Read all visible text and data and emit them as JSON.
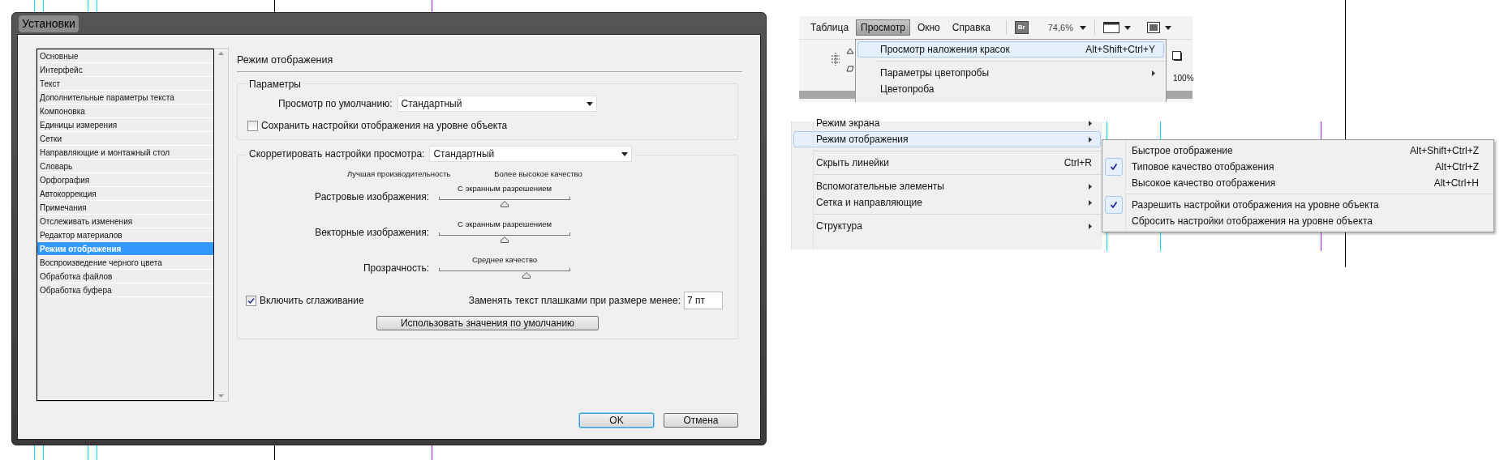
{
  "dialog": {
    "title": "Установки",
    "categories": [
      {
        "label": "Основные",
        "selected": false
      },
      {
        "label": "Интерфейс",
        "selected": false
      },
      {
        "label": "Текст",
        "selected": false
      },
      {
        "label": "Дополнительные параметры текста",
        "selected": false
      },
      {
        "label": "Компоновка",
        "selected": false
      },
      {
        "label": "Единицы измерения",
        "selected": false
      },
      {
        "label": "Сетки",
        "selected": false
      },
      {
        "label": "Направляющие и монтажный стол",
        "selected": false
      },
      {
        "label": "Словарь",
        "selected": false
      },
      {
        "label": "Орфография",
        "selected": false
      },
      {
        "label": "Автокоррекция",
        "selected": false
      },
      {
        "label": "Примечания",
        "selected": false
      },
      {
        "label": "Отслеживать изменения",
        "selected": false
      },
      {
        "label": "Редактор материалов",
        "selected": false
      },
      {
        "label": "Режим отображения",
        "selected": true
      },
      {
        "label": "Воспроизведение черного цвета",
        "selected": false
      },
      {
        "label": "Обработка файлов",
        "selected": false
      },
      {
        "label": "Обработка буфера",
        "selected": false
      }
    ],
    "panel": {
      "heading": "Режим отображения",
      "params_group": {
        "title": "Параметры",
        "default_view_label": "Просмотр по умолчанию:",
        "default_view_value": "Стандартный",
        "keep_object_settings": {
          "label": "Сохранить настройки отображения на уровне объекта",
          "checked": false
        }
      },
      "adjust_group": {
        "label": "Скорретировать настройки просмотра:",
        "value": "Стандартный",
        "scale_left": "Лучшая производительность",
        "scale_right": "Более высокое качество",
        "sliders": [
          {
            "label": "Растровые изображения:",
            "reading": "С экранным разрешением",
            "level": 0.5
          },
          {
            "label": "Векторные изображения:",
            "reading": "С экранным разрешением",
            "level": 0.5
          },
          {
            "label": "Прозрачность:",
            "reading": "Среднее качество",
            "level": 0.667
          }
        ],
        "antialias": {
          "label": "Включить сглаживание",
          "checked": true
        },
        "greek_label": "Заменять текст плашками при размере менее:",
        "greek_value": "7 пт",
        "defaults_button": "Использовать значения по умолчанию"
      }
    },
    "buttons": [
      {
        "label": "OK",
        "default": true
      },
      {
        "label": "Отмена",
        "default": false
      }
    ]
  },
  "menubar": {
    "items": [
      {
        "label": "Таблица",
        "selected": false
      },
      {
        "label": "Просмотр",
        "selected": true
      },
      {
        "label": "Окно",
        "selected": false
      },
      {
        "label": "Справка",
        "selected": false
      }
    ],
    "bridge_badge": "Br",
    "zoom": "74,6%",
    "toolbar_zoom": "100%"
  },
  "view_menu": {
    "items": [
      {
        "label": "Просмотр наложения красок",
        "shortcut": "Alt+Shift+Ctrl+Y",
        "highlighted": true,
        "submenu": false,
        "separator_after": true
      },
      {
        "label": "Параметры цветопробы",
        "highlighted": false,
        "submenu": true,
        "separator_after": false
      },
      {
        "label": "Цветопроба",
        "highlighted": false,
        "submenu": false
      }
    ]
  },
  "view_menu_lower": {
    "items": [
      {
        "label": "Режим экрана",
        "highlighted": false,
        "submenu": true,
        "separator_after": false
      },
      {
        "label": "Режим отображения",
        "highlighted": true,
        "submenu": true,
        "separator_after": true
      },
      {
        "label": "Скрыть линейки",
        "shortcut": "Ctrl+R",
        "highlighted": false,
        "submenu": false,
        "separator_after": true
      },
      {
        "label": "Вспомогательные элементы",
        "highlighted": false,
        "submenu": true,
        "separator_after": false
      },
      {
        "label": "Сетка и направляющие",
        "highlighted": false,
        "submenu": true,
        "separator_after": true
      },
      {
        "label": "Структура",
        "highlighted": false,
        "submenu": true,
        "separator_after": false
      }
    ]
  },
  "display_submenu": {
    "items": [
      {
        "label": "Быстрое отображение",
        "shortcut": "Alt+Shift+Ctrl+Z",
        "checked": false,
        "separator_after": false
      },
      {
        "label": "Типовое качество отображения",
        "shortcut": "Alt+Ctrl+Z",
        "checked": true,
        "separator_after": false
      },
      {
        "label": "Высокое качество отображения",
        "shortcut": "Alt+Ctrl+H",
        "checked": false,
        "separator_after": true
      },
      {
        "label": "Разрешить настройки отображения на уровне объекта",
        "checked": true,
        "separator_after": false
      },
      {
        "label": "Сбросить настройки отображения на уровне объекта",
        "checked": false,
        "separator_after": false
      }
    ]
  }
}
